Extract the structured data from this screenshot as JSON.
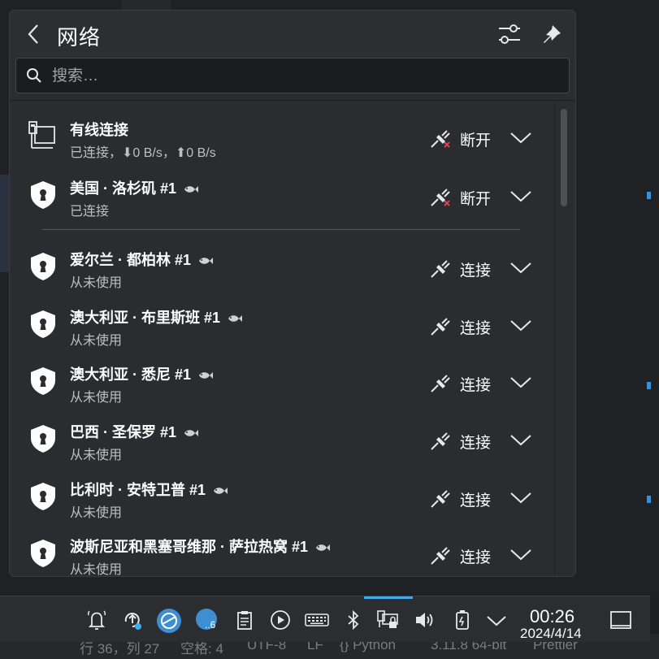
{
  "window": {
    "title": "网络"
  },
  "search": {
    "placeholder": "搜索…"
  },
  "connections": [
    {
      "name": "有线连接",
      "status": "已连接，⬇0 B/s，⬆0 B/s",
      "action": "断开",
      "icon": "wired-network-icon",
      "active": true,
      "vpn": false
    },
    {
      "name": "美国 · 洛杉矶 #1",
      "status": "已连接",
      "action": "断开",
      "icon": "vpn-shield-icon",
      "active": true,
      "vpn": true
    },
    {
      "name": "爱尔兰 · 都柏林 #1",
      "status": "从未使用",
      "action": "连接",
      "icon": "vpn-shield-icon",
      "active": false,
      "vpn": true
    },
    {
      "name": "澳大利亚 · 布里斯班 #1",
      "status": "从未使用",
      "action": "连接",
      "icon": "vpn-shield-icon",
      "active": false,
      "vpn": true
    },
    {
      "name": "澳大利亚 · 悉尼 #1",
      "status": "从未使用",
      "action": "连接",
      "icon": "vpn-shield-icon",
      "active": false,
      "vpn": true
    },
    {
      "name": "巴西 · 圣保罗 #1",
      "status": "从未使用",
      "action": "连接",
      "icon": "vpn-shield-icon",
      "active": false,
      "vpn": true
    },
    {
      "name": "比利时 · 安特卫普 #1",
      "status": "从未使用",
      "action": "连接",
      "icon": "vpn-shield-icon",
      "active": false,
      "vpn": true
    },
    {
      "name": "波斯尼亚和黑塞哥维那 · 萨拉热窝 #1",
      "status": "从未使用",
      "action": "连接",
      "icon": "vpn-shield-icon",
      "active": false,
      "vpn": true
    }
  ],
  "taskbar": {
    "time": "00:26",
    "date": "2024/4/14",
    "badge": "..6",
    "icons": [
      "notification-bell-icon",
      "update-icon",
      "network-share-icon",
      "chat-icon",
      "clipboard-icon",
      "media-play-icon",
      "keyboard-icon",
      "bluetooth-icon",
      "network-tray-icon",
      "volume-icon",
      "battery-icon",
      "chevron-up-icon",
      "show-desktop-icon"
    ]
  },
  "statusbar": {
    "items": [
      "行 36，列 27",
      "空格: 4",
      "UTF-8",
      "LF",
      "{} Python",
      "3.11.8 64-bit",
      "Prettier"
    ]
  },
  "colors": {
    "accent": "#3daee9",
    "panel": "#2a2c30",
    "disconnect_x": "#da4453"
  }
}
